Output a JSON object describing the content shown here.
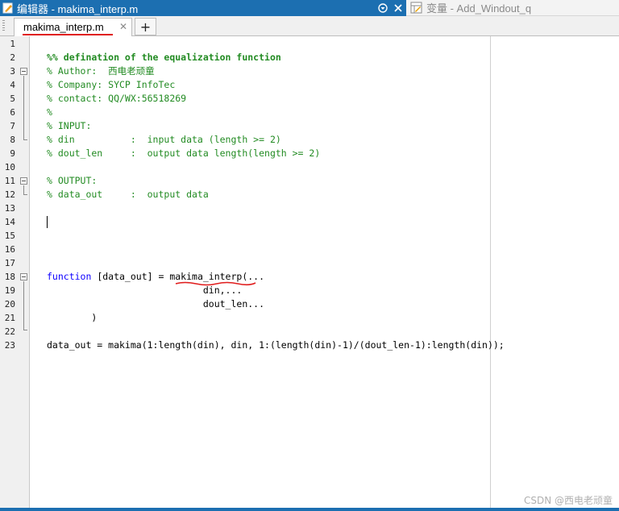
{
  "window": {
    "active_title": "编辑器 - makima_interp.m",
    "inactive_title": "变量 - Add_Windout_q"
  },
  "tabs": [
    {
      "label": "makima_interp.m",
      "close_glyph": "✕"
    }
  ],
  "new_tab_label": "+",
  "line_numbers": [
    "1",
    "2",
    "3",
    "4",
    "5",
    "6",
    "7",
    "8",
    "9",
    "10",
    "11",
    "12",
    "13",
    "14",
    "15",
    "16",
    "17",
    "18",
    "19",
    "20",
    "21",
    "22",
    "23"
  ],
  "code": {
    "l2": "%% defination of the equalization function",
    "l3_prefix": "% Author:  ",
    "l3_author": "西电老顽童",
    "l4": "% Company: SYCP InfoTec",
    "l5": "% contact: QQ/WX:56518269",
    "l6": "%",
    "l7": "% INPUT:",
    "l8": "% din          :  input data (length >= 2)",
    "l9": "% dout_len     :  output data length(length >= 2)",
    "l11": "% OUTPUT:",
    "l12": "% data_out     :  output data",
    "l18_kw": "function",
    "l18_rest": " [data_out] = makima_interp(...",
    "l19": "                            din,...",
    "l20": "                            dout_len...",
    "l21": "        )",
    "l23": "data_out = makima(1:length(din), din, 1:(length(din)-1)/(dout_len-1):length(din));"
  },
  "watermark": "CSDN @西电老顽童",
  "colors": {
    "title_active_bg": "#1c6fb1",
    "comment": "#228b22",
    "keyword": "#0e00ff",
    "annotation_red": "#e01d1d"
  }
}
